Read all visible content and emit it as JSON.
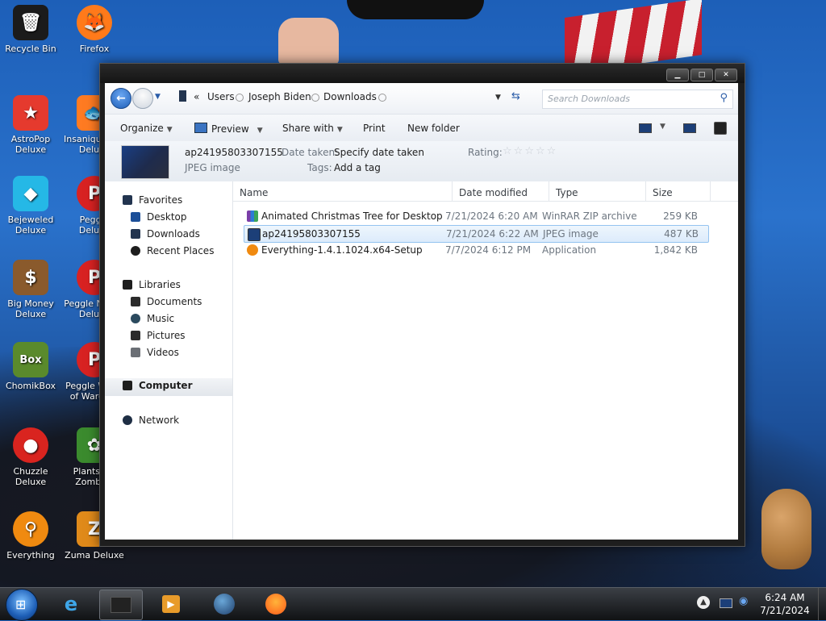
{
  "desktop": {
    "icons": [
      {
        "label": "Recycle Bin",
        "icon": "recycle-bin-icon",
        "glyph": "🗑",
        "color": "#1b1b1b"
      },
      {
        "label": "Firefox",
        "icon": "firefox-icon",
        "glyph": "🦊",
        "color": "#ff7a1a"
      },
      {
        "label": "AstroPop Deluxe",
        "icon": "astropop-icon",
        "glyph": "★",
        "color": "#e53a2e"
      },
      {
        "label": "Insaniquarium Deluxe",
        "icon": "insaniquarium-icon",
        "glyph": "🐟",
        "color": "#ff7b22"
      },
      {
        "label": "Bejeweled Deluxe",
        "icon": "bejeweled-icon",
        "glyph": "◆",
        "color": "#25b8e6"
      },
      {
        "label": "Peggle Deluxe",
        "icon": "peggle-icon",
        "glyph": "P",
        "color": "#d82222"
      },
      {
        "label": "Big Money Deluxe",
        "icon": "big-money-icon",
        "glyph": "$",
        "color": "#8a5a2c"
      },
      {
        "label": "Peggle Nights Deluxe",
        "icon": "peggle-nights-icon",
        "glyph": "P",
        "color": "#d82222"
      },
      {
        "label": "ChomikBox",
        "icon": "chomikbox-icon",
        "glyph": "Box",
        "color": "#5a8a2c"
      },
      {
        "label": "Peggle World of Warcraft",
        "icon": "peggle-wow-icon",
        "glyph": "P",
        "color": "#d82222"
      },
      {
        "label": "Chuzzle Deluxe",
        "icon": "chuzzle-icon",
        "glyph": "●",
        "color": "#d9241f"
      },
      {
        "label": "Plants vs. Zombies",
        "icon": "plants-zombies-icon",
        "glyph": "✿",
        "color": "#3b8b2e"
      },
      {
        "label": "Everything",
        "icon": "everything-icon",
        "glyph": "⚲",
        "color": "#f08a10"
      },
      {
        "label": "Zuma Deluxe",
        "icon": "zuma-icon",
        "glyph": "Z",
        "color": "#e08a1a"
      }
    ]
  },
  "window": {
    "buttons": {
      "minimize": "▁",
      "maximize": "□",
      "close": "✕"
    },
    "address": {
      "prefix": "«",
      "crumbs": [
        "Users",
        "Joseph Biden",
        "Downloads"
      ],
      "search_placeholder": "Search Downloads"
    },
    "commands": {
      "organize": "Organize",
      "preview": "Preview",
      "share_with": "Share with",
      "print": "Print",
      "new_folder": "New folder"
    },
    "details": {
      "filename": "ap24195803307155",
      "filetype": "JPEG image",
      "date_taken_label": "Date taken:",
      "date_taken_value": "Specify date taken",
      "tags_label": "Tags:",
      "tags_value": "Add a tag",
      "rating_label": "Rating:",
      "rating_stars": [
        "☆",
        "☆",
        "☆",
        "☆",
        "☆"
      ]
    },
    "nav": {
      "favorites": "Favorites",
      "desktop": "Desktop",
      "downloads": "Downloads",
      "recent_places": "Recent Places",
      "libraries": "Libraries",
      "documents": "Documents",
      "music": "Music",
      "pictures": "Pictures",
      "videos": "Videos",
      "computer": "Computer",
      "network": "Network"
    },
    "columns": {
      "name": "Name",
      "date_modified": "Date modified",
      "type": "Type",
      "size": "Size"
    },
    "files": [
      {
        "name": "Animated Christmas Tree for Desktop",
        "date": "7/21/2024 6:20 AM",
        "type": "WinRAR ZIP archive",
        "size": "259 KB",
        "selected": false
      },
      {
        "name": "ap24195803307155",
        "date": "7/21/2024 6:22 AM",
        "type": "JPEG image",
        "size": "487 KB",
        "selected": true
      },
      {
        "name": "Everything-1.4.1.1024.x64-Setup",
        "date": "7/7/2024 6:12 PM",
        "type": "Application",
        "size": "1,842 KB",
        "selected": false
      }
    ]
  },
  "taskbar": {
    "clock_time": "6:24 AM",
    "clock_date": "7/21/2024",
    "pinned": [
      "internet-explorer-icon",
      "explorer-icon",
      "media-player-icon",
      "network-globe-icon",
      "firefox-icon"
    ]
  },
  "colors": {
    "accent": "#1f5fb8",
    "selection": "#dcebfb",
    "desktop": "#1d5fb8"
  }
}
